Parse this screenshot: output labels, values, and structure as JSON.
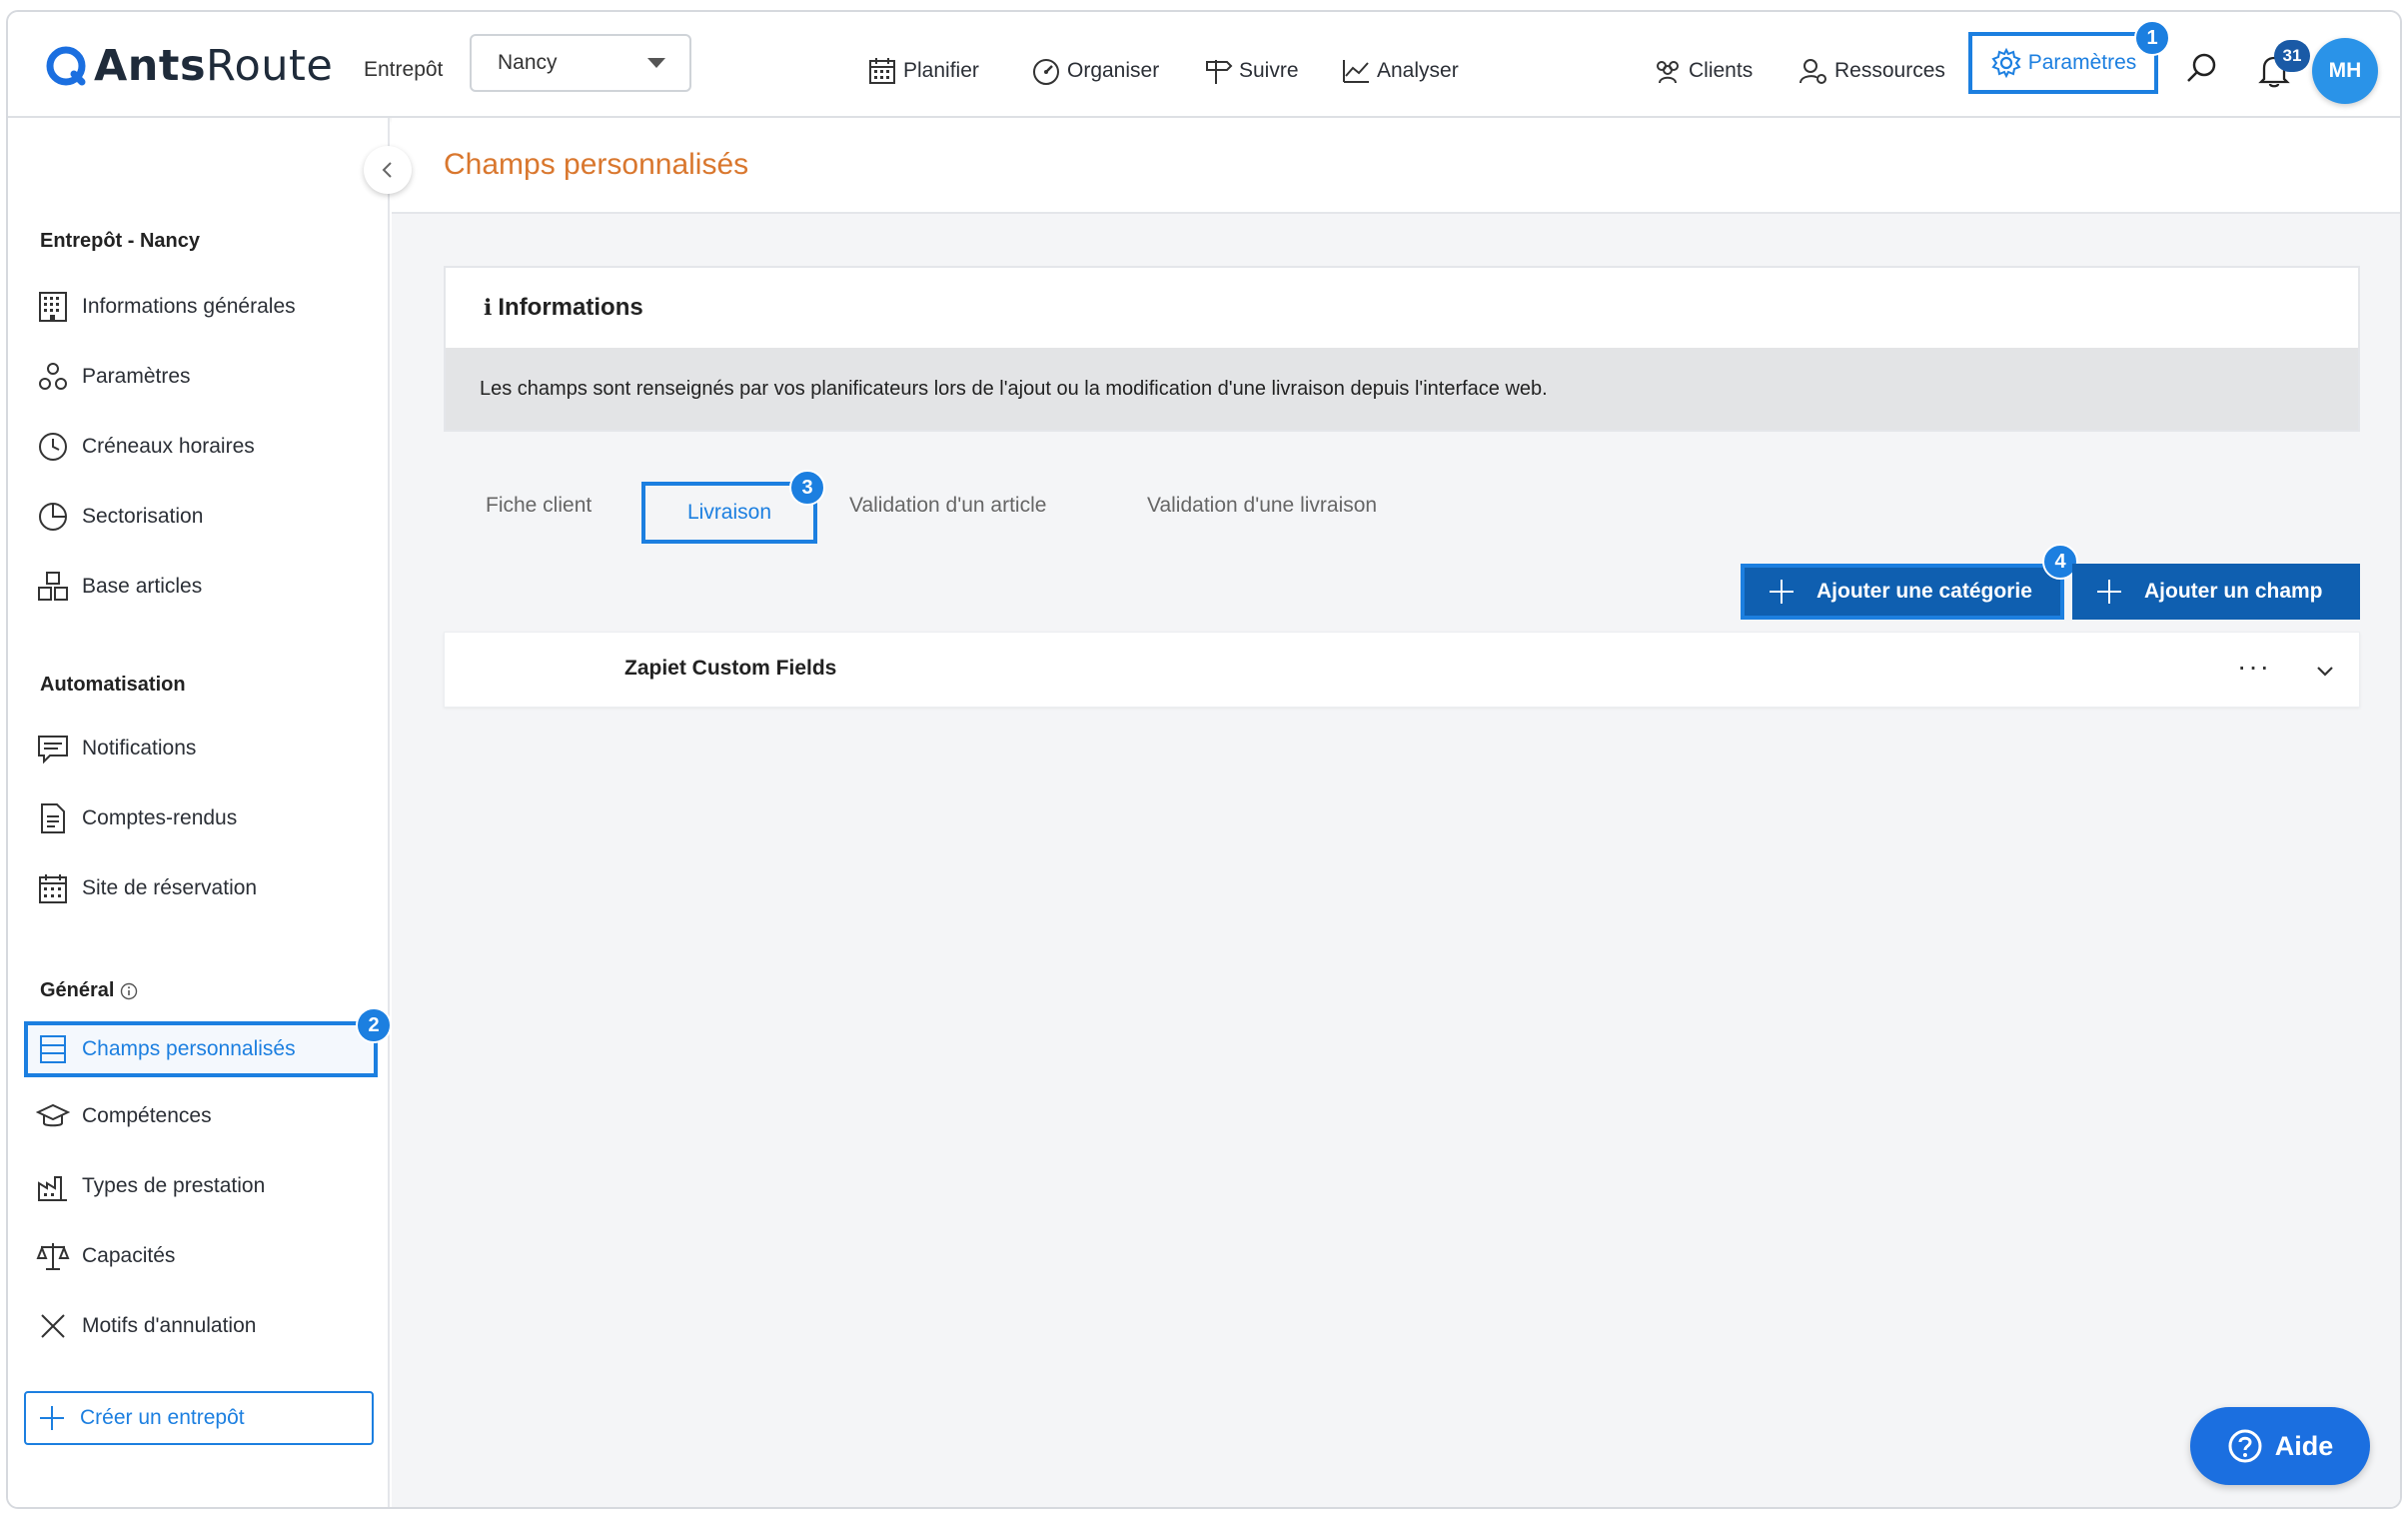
{
  "header": {
    "logo_text_bold": "Ants",
    "logo_text_rest": "Route",
    "warehouse_label": "Entrepôt",
    "warehouse_value": "Nancy",
    "nav": [
      {
        "label": "Planifier",
        "icon": "calendar-icon"
      },
      {
        "label": "Organiser",
        "icon": "gauge-icon"
      },
      {
        "label": "Suivre",
        "icon": "signpost-icon"
      },
      {
        "label": "Analyser",
        "icon": "chart-icon"
      },
      {
        "label": "Clients",
        "icon": "users-icon"
      },
      {
        "label": "Ressources",
        "icon": "user-gear-icon"
      },
      {
        "label": "Paramètres",
        "icon": "gear-icon"
      }
    ],
    "notification_count": "31",
    "avatar_initials": "MH",
    "step_markers": [
      "1",
      "2",
      "3",
      "4"
    ]
  },
  "sidebar": {
    "section_warehouse": "Entrepôt - Nancy",
    "warehouse_items": [
      {
        "label": "Informations générales",
        "icon": "building-icon"
      },
      {
        "label": "Paramètres",
        "icon": "settings-nodes-icon"
      },
      {
        "label": "Créneaux horaires",
        "icon": "clock-icon"
      },
      {
        "label": "Sectorisation",
        "icon": "pie-chart-icon"
      },
      {
        "label": "Base articles",
        "icon": "boxes-icon"
      }
    ],
    "section_automation": "Automatisation",
    "automation_items": [
      {
        "label": "Notifications",
        "icon": "message-icon"
      },
      {
        "label": "Comptes-rendus",
        "icon": "document-icon"
      },
      {
        "label": "Site de réservation",
        "icon": "calendar-grid-icon"
      }
    ],
    "section_general": "Général",
    "general_items": [
      {
        "label": "Champs personnalisés",
        "icon": "fields-icon"
      },
      {
        "label": "Compétences",
        "icon": "graduation-cap-icon"
      },
      {
        "label": "Types de prestation",
        "icon": "factory-icon"
      },
      {
        "label": "Capacités",
        "icon": "scales-icon"
      },
      {
        "label": "Motifs d'annulation",
        "icon": "x-icon"
      }
    ],
    "create_warehouse": "Créer un entrepôt"
  },
  "main": {
    "title": "Champs personnalisés",
    "info_title": "Informations",
    "info_text": "Les champs sont renseignés par vos planificateurs lors de l'ajout ou la modification d'une livraison depuis l'interface web.",
    "tabs": [
      "Fiche client",
      "Livraison",
      "Validation d'un article",
      "Validation d'une livraison"
    ],
    "active_tab": "Livraison",
    "add_category": "Ajouter une catégorie",
    "add_field": "Ajouter un champ",
    "categories": [
      {
        "name": "Zapiet Custom Fields",
        "menu": "···"
      }
    ]
  },
  "help_button": "Aide",
  "colors": {
    "accent": "#1c7fe0",
    "primary_button": "#0f5fb0",
    "title_orange": "#d9772e",
    "avatar": "#2a93e8"
  }
}
